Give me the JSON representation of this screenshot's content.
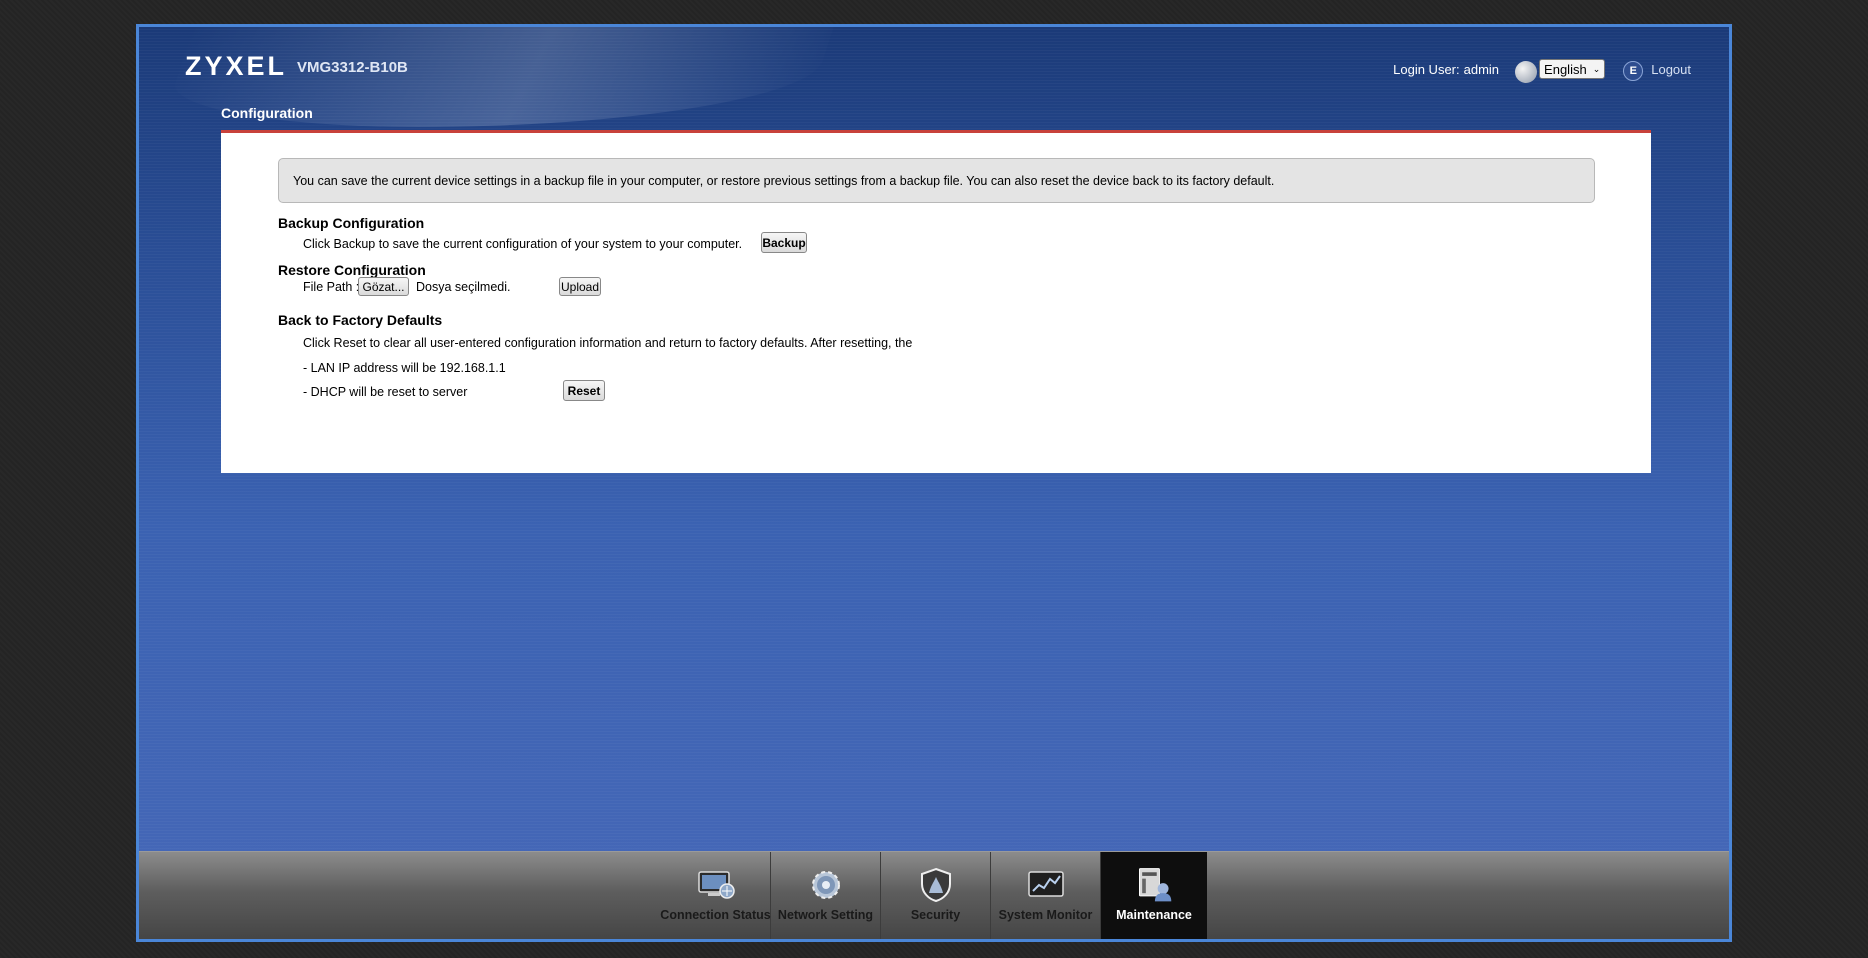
{
  "header": {
    "brand": "ZYXEL",
    "model": "VMG3312-B10B",
    "login_label": "Login User:",
    "login_user": "admin",
    "language": "English",
    "logout": "Logout"
  },
  "page": {
    "title": "Configuration"
  },
  "info": "You can save the current device settings in a backup file in your computer, or restore previous settings from a backup file. You can also reset the device back to its factory default.",
  "backup": {
    "title": "Backup Configuration",
    "description": "Click Backup to save the current configuration of your system to your computer.",
    "button": "Backup"
  },
  "restore": {
    "title": "Restore Configuration",
    "file_path_label": "File Path :",
    "browse_button": "Gözat...",
    "file_status": "Dosya seçilmedi.",
    "upload_button": "Upload"
  },
  "factory": {
    "title": "Back to Factory Defaults",
    "description": "Click Reset to clear all user-entered configuration information and return to factory defaults. After resetting, the",
    "line_lan": "- LAN IP address will be 192.168.1.1",
    "line_dhcp": "- DHCP will be reset to server",
    "button": "Reset"
  },
  "nav": {
    "items": [
      {
        "label": "Connection Status",
        "icon": "connection-status-icon"
      },
      {
        "label": "Network Setting",
        "icon": "network-setting-icon"
      },
      {
        "label": "Security",
        "icon": "security-shield-icon"
      },
      {
        "label": "System Monitor",
        "icon": "system-monitor-icon"
      },
      {
        "label": "Maintenance",
        "icon": "maintenance-icon"
      }
    ],
    "active": "Maintenance"
  },
  "colors": {
    "accent_red": "#c8413b",
    "frame_border": "#4a86d8",
    "background_blue": "#3b62b2"
  }
}
